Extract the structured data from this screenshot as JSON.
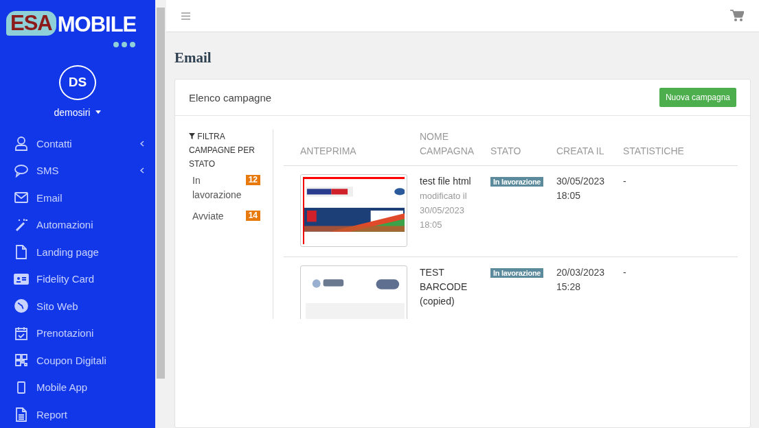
{
  "logo": {
    "part_1": "ESA",
    "part_2": "MOBILE"
  },
  "user": {
    "initials": "DS",
    "name": "demosiri"
  },
  "sidebar": {
    "items": [
      {
        "label": "Contatti",
        "expandable": true
      },
      {
        "label": "SMS",
        "expandable": true
      },
      {
        "label": "Email",
        "expandable": false
      },
      {
        "label": "Automazioni",
        "expandable": false
      },
      {
        "label": "Landing page",
        "expandable": false
      },
      {
        "label": "Fidelity Card",
        "expandable": false
      },
      {
        "label": "Sito Web",
        "expandable": false
      },
      {
        "label": "Prenotazioni",
        "expandable": false
      },
      {
        "label": "Coupon Digitali",
        "expandable": false
      },
      {
        "label": "Mobile App",
        "expandable": false
      },
      {
        "label": "Report",
        "expandable": false
      }
    ]
  },
  "page_title": "Email",
  "card": {
    "title": "Elenco campagne",
    "button": "Nuova campagna",
    "filter": {
      "title": "FILTRA CAMPAGNE PER STATO",
      "items": [
        {
          "label": "In lavorazione",
          "count": "12"
        },
        {
          "label": "Avviate",
          "count": "14"
        }
      ]
    },
    "table": {
      "columns": [
        "ANTEPRIMA",
        "NOME CAMPAGNA",
        "STATO",
        "CREATA IL",
        "STATISTICHE"
      ],
      "rows": [
        {
          "name": "test file html",
          "modified": "modificato il 30/05/2023 18:05",
          "status": "In lavorazione",
          "created": "30/05/2023 18:05",
          "statistics": "-"
        },
        {
          "name": "TEST BARCODE (copied)",
          "status": "In lavorazione",
          "created": "20/03/2023 15:28",
          "statistics": "-"
        }
      ]
    }
  }
}
